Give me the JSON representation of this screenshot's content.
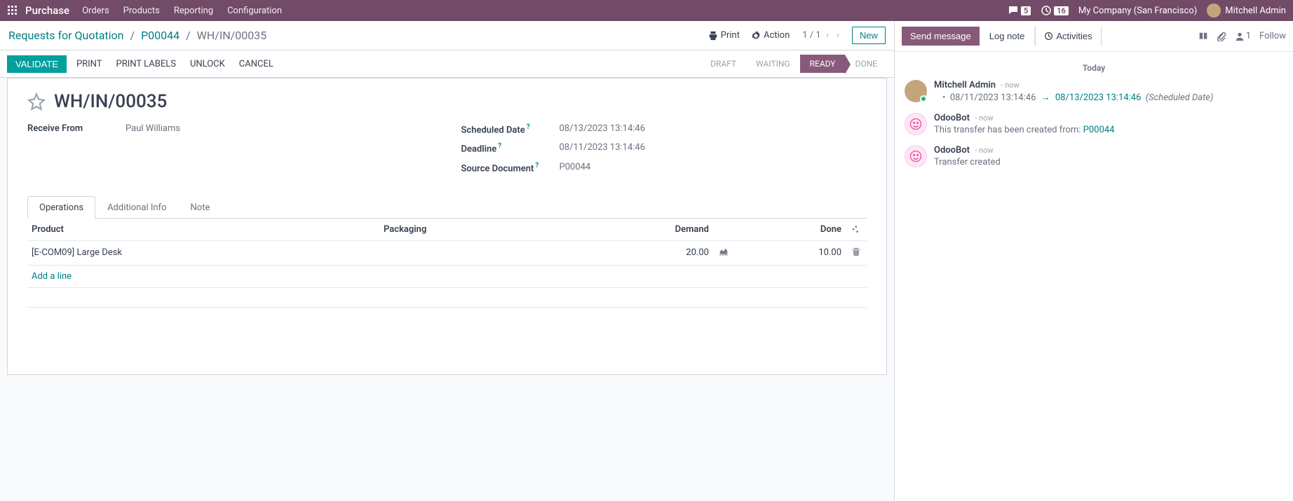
{
  "topnav": {
    "brand": "Purchase",
    "menu": [
      "Orders",
      "Products",
      "Reporting",
      "Configuration"
    ],
    "chat_count": "5",
    "clock_count": "16",
    "company": "My Company (San Francisco)",
    "user": "Mitchell Admin"
  },
  "breadcrumb": {
    "root": "Requests for Quotation",
    "parent": "P00044",
    "current": "WH/IN/00035",
    "print": "Print",
    "action": "Action",
    "pager": "1 / 1",
    "new_btn": "New"
  },
  "actions": {
    "validate": "VALIDATE",
    "print": "PRINT",
    "print_labels": "PRINT LABELS",
    "unlock": "UNLOCK",
    "cancel": "CANCEL"
  },
  "status": {
    "draft": "DRAFT",
    "waiting": "WAITING",
    "ready": "READY",
    "done": "DONE"
  },
  "form": {
    "title": "WH/IN/00035",
    "receive_from_label": "Receive From",
    "receive_from": "Paul Williams",
    "scheduled_label": "Scheduled Date",
    "scheduled": "08/13/2023 13:14:46",
    "deadline_label": "Deadline",
    "deadline": "08/11/2023 13:14:46",
    "source_label": "Source Document",
    "source": "P00044"
  },
  "tabs": {
    "operations": "Operations",
    "additional": "Additional Info",
    "note": "Note"
  },
  "table": {
    "headers": {
      "product": "Product",
      "packaging": "Packaging",
      "demand": "Demand",
      "done": "Done"
    },
    "rows": [
      {
        "product": "[E-COM09] Large Desk",
        "packaging": "",
        "demand": "20.00",
        "done": "10.00"
      }
    ],
    "add_line": "Add a line"
  },
  "chatter": {
    "send": "Send message",
    "log": "Log note",
    "activities": "Activities",
    "follower_count": "1",
    "follow": "Follow",
    "date": "Today",
    "messages": [
      {
        "author": "Mitchell Admin",
        "time": "now",
        "avatar": "user",
        "change_from": "08/11/2023 13:14:46",
        "change_to": "08/13/2023 13:14:46",
        "change_field": "(Scheduled Date)"
      },
      {
        "author": "OdooBot",
        "time": "now",
        "avatar": "bot",
        "text_prefix": "This transfer has been created from: ",
        "link": "P00044"
      },
      {
        "author": "OdooBot",
        "time": "now",
        "avatar": "bot",
        "text": "Transfer created"
      }
    ]
  }
}
